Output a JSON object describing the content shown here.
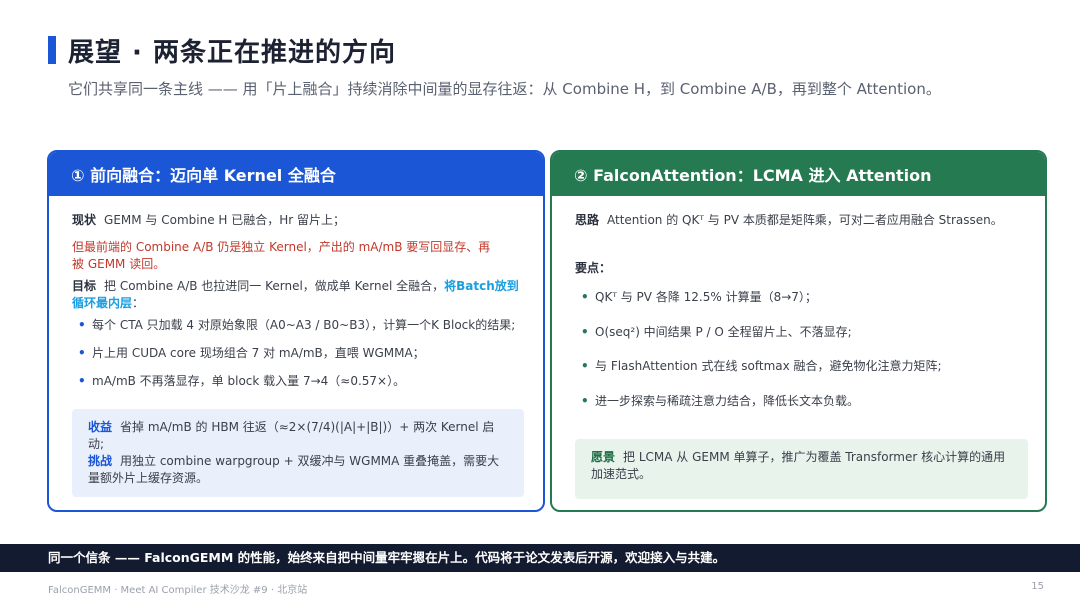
{
  "header": {
    "title": "展望 · 两条正在推进的方向",
    "subtitle": "它们共享同一条主线 —— 用「片上融合」持续消除中间量的显存往返：从 Combine H，到 Combine A/B，再到整个 Attention。"
  },
  "left_card": {
    "title": "① 前向融合：迈向单 Kernel 全融合",
    "status_label": "现状",
    "status_text": "GEMM 与 Combine H 已融合，Hr 留片上；",
    "warning_text": "但最前端的 Combine A/B 仍是独立 Kernel，产出的 mA/mB 要写回显存、再被 GEMM 读回。",
    "goal_label": "目标",
    "goal_text": "把 Combine A/B 也拉进同一 Kernel，做成单 Kernel 全融合，",
    "goal_highlight": "将Batch放到循环最内层",
    "goal_tail": "：",
    "bullets": [
      "每个 CTA 只加载 4 对原始象限（A0~A3 / B0~B3），计算一个K Block的结果;",
      "片上用 CUDA core 现场组合 7 对 mA/mB，直喂 WGMMA；",
      "mA/mB 不再落显存，单 block 载入量 7→4（≈0.57×）。"
    ],
    "gain_label": "收益",
    "gain_text": "省掉 mA/mB 的 HBM 往返（≈2×(7/4)(|A|+|B|)）+ 两次 Kernel 启动;",
    "challenge_label": "挑战",
    "challenge_text": "用独立 combine warpgroup + 双缓冲与 WGMMA 重叠掩盖，需要大量额外片上缓存资源。"
  },
  "right_card": {
    "title": "② FalconAttention：LCMA 进入 Attention",
    "idea_label": "思路",
    "idea_text": "Attention 的 QKᵀ 与 PV 本质都是矩阵乘，可对二者应用融合 Strassen。",
    "points_label": "要点：",
    "bullets": [
      "QKᵀ 与 PV 各降 12.5% 计算量（8→7）；",
      "O(seq²) 中间结果 P / O 全程留片上、不落显存;",
      "与 FlashAttention 式在线 softmax 融合，避免物化注意力矩阵;",
      "进一步探索与稀疏注意力结合，降低长文本负载。"
    ],
    "vision_label": "愿景",
    "vision_text": "把 LCMA 从 GEMM 单算子，推广为覆盖 Transformer 核心计算的通用加速范式。"
  },
  "footer": {
    "band_text": "同一个信条 —— FalconGEMM 的性能，始终来自把中间量牢牢摁在片上。代码将于论文发表后开源，欢迎接入与共建。",
    "source": "FalconGEMM · Meet AI Compiler 技术沙龙 #9 · 北京站",
    "page_number": "15"
  },
  "colors": {
    "accent_blue": "#1a56d6",
    "accent_green": "#257a52",
    "warning_red": "#c0392b",
    "highlight": "#1a9ee0",
    "footer_band": "#131b30"
  }
}
